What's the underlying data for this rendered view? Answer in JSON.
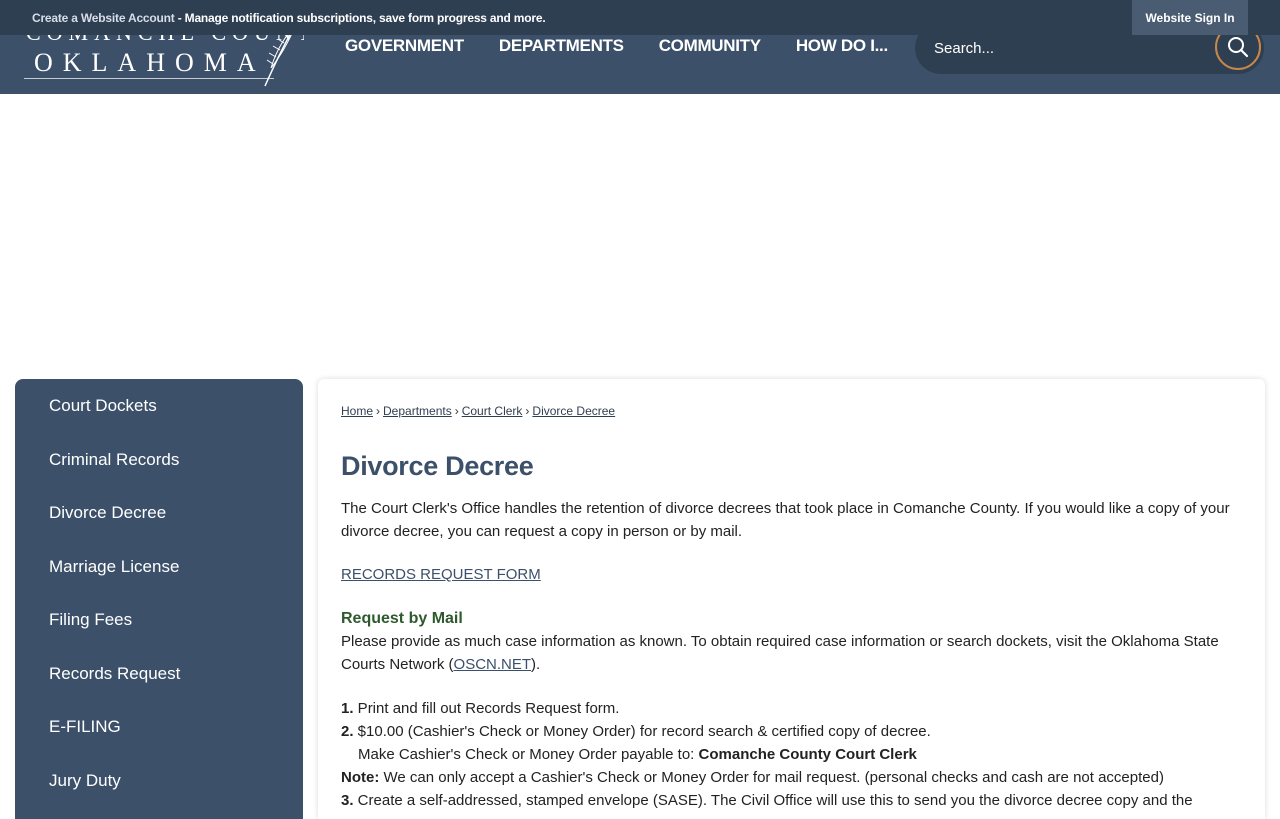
{
  "top_bar": {
    "account_link": "Create a Website Account",
    "message": " - Manage notification subscriptions, save form progress and more.",
    "sign_in": "Website Sign In"
  },
  "logo": {
    "line1": "COMANCHE COUNTY",
    "line2": "OKLAHOMA"
  },
  "nav": [
    "GOVERNMENT",
    "DEPARTMENTS",
    "COMMUNITY",
    "HOW DO I..."
  ],
  "search": {
    "placeholder": "Search..."
  },
  "sidebar": {
    "items": [
      "Court Dockets",
      "Criminal Records",
      "Divorce Decree",
      "Marriage License",
      "Filing Fees",
      "Records Request",
      "E-FILING",
      "Jury Duty"
    ]
  },
  "breadcrumb": [
    "Home",
    "Departments",
    "Court Clerk",
    "Divorce Decree"
  ],
  "breadcrumb_sep": "›",
  "page": {
    "title": "Divorce Decree",
    "intro_1": "The Court Clerk's Office handles the retention of divorce decrees that took place in Comanche County. If you would like a copy of your",
    "intro_2": "divorce decree, you can request a copy in person or by mail.",
    "records_link": "RECORDS REQUEST FORM ",
    "mail_heading": "Request by Mail",
    "mail_1": "Please provide as much case information as known. To obtain required case information or search dockets, visit the Oklahoma State",
    "mail_2_pre": "Courts Network (",
    "mail_2_link": "OSCN.NET",
    "mail_2_post": ").",
    "step1_num": "1.",
    "step1": " Print and fill out Records Request form.",
    "step2_num": "2.",
    "step2": " $10.00 (Cashier's Check or Money Order) for record search & certified copy of decree.",
    "step2b_pre": "Make Cashier's Check or Money Order payable to: ",
    "step2b_bold": "Comanche County Court Clerk",
    "note_label": "Note:",
    "note": " We can only accept a Cashier's Check or Money Order for mail request. (personal checks and cash are not accepted)",
    "step3_num": "3.",
    "step3": " Create a self-addressed, stamped envelope (SASE). The Civil Office will use this to send you the divorce decree copy and the"
  }
}
